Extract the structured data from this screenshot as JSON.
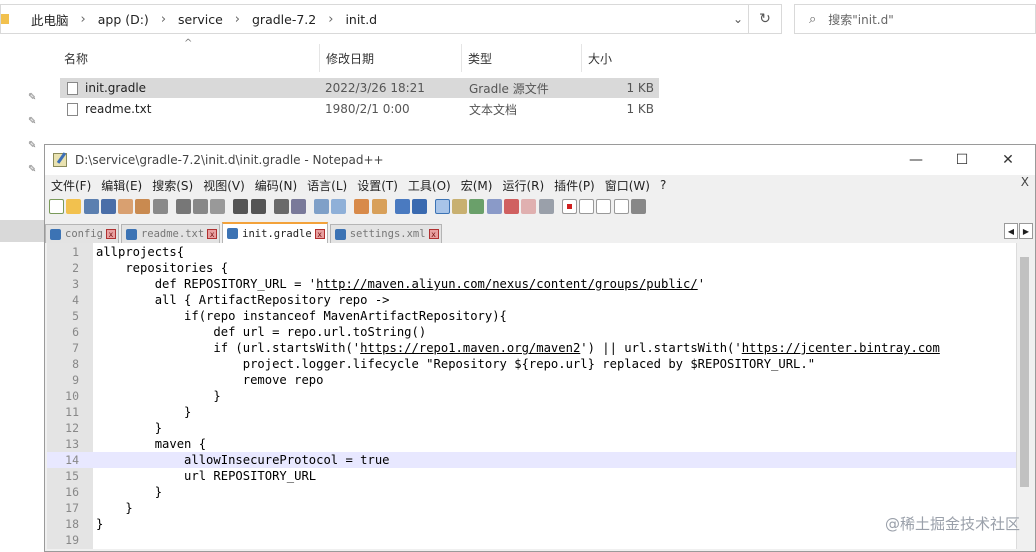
{
  "explorer": {
    "breadcrumb": [
      "此电脑",
      "app (D:)",
      "service",
      "gradle-7.2",
      "init.d"
    ],
    "search_placeholder": "搜索\"init.d\"",
    "columns": [
      "名称",
      "修改日期",
      "类型",
      "大小"
    ],
    "files": [
      {
        "name": "init.gradle",
        "date": "2022/3/26 18:21",
        "type": "Gradle 源文件",
        "size": "1 KB",
        "selected": true
      },
      {
        "name": "readme.txt",
        "date": "1980/2/1 0:00",
        "type": "文本文档",
        "size": "1 KB",
        "selected": false
      }
    ]
  },
  "notepad": {
    "title": "D:\\service\\gradle-7.2\\init.d\\init.gradle - Notepad++",
    "menu": [
      "文件(F)",
      "编辑(E)",
      "搜索(S)",
      "视图(V)",
      "编码(N)",
      "语言(L)",
      "设置(T)",
      "工具(O)",
      "宏(M)",
      "运行(R)",
      "插件(P)",
      "窗口(W)",
      "?"
    ],
    "menu_close": "X",
    "window_buttons": {
      "minimize": "—",
      "maximize": "☐",
      "close": "✕"
    },
    "tabs": [
      {
        "label": "config",
        "active": false
      },
      {
        "label": "readme.txt",
        "active": false
      },
      {
        "label": "init.gradle",
        "active": true
      },
      {
        "label": "settings.xml",
        "active": false
      }
    ],
    "current_line": 14,
    "lines": [
      {
        "n": "1",
        "code": "allprojects{"
      },
      {
        "n": "2",
        "code": "    repositories {"
      },
      {
        "n": "3",
        "pre": "        def REPOSITORY_URL = '",
        "url": "http://maven.aliyun.com/nexus/content/groups/public/",
        "post": "'"
      },
      {
        "n": "4",
        "code": "        all { ArtifactRepository repo ->"
      },
      {
        "n": "5",
        "code": "            if(repo instanceof MavenArtifactRepository){"
      },
      {
        "n": "6",
        "code": "                def url = repo.url.toString()"
      },
      {
        "n": "7",
        "pre": "                if (url.startsWith('",
        "url": "https://repo1.maven.org/maven2",
        "mid": "') || url.startsWith('",
        "url2": "https://jcenter.bintray.com"
      },
      {
        "n": "8",
        "code": "                    project.logger.lifecycle \"Repository ${repo.url} replaced by $REPOSITORY_URL.\""
      },
      {
        "n": "9",
        "code": "                    remove repo"
      },
      {
        "n": "10",
        "code": "                }"
      },
      {
        "n": "11",
        "code": "            }"
      },
      {
        "n": "12",
        "code": "        }"
      },
      {
        "n": "13",
        "code": "        maven {"
      },
      {
        "n": "14",
        "code": "            allowInsecureProtocol = true"
      },
      {
        "n": "15",
        "code": "            url REPOSITORY_URL"
      },
      {
        "n": "16",
        "code": "        }"
      },
      {
        "n": "17",
        "code": "    }"
      },
      {
        "n": "18",
        "code": "}"
      },
      {
        "n": "19",
        "code": ""
      }
    ]
  },
  "watermark": "@稀土掘金技术社区"
}
